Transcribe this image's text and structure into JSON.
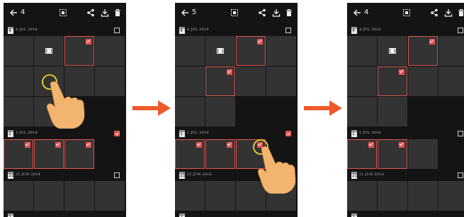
{
  "colors": {
    "background": "#141414",
    "thumbnail": "#333333",
    "selection": "#e8524f",
    "arrow": "#ee5a2a",
    "hand": "#f2b46e",
    "touch_ring": "#f2d22e"
  },
  "icons": [
    "back-arrow-icon",
    "select-all-icon",
    "share-icon",
    "download-icon",
    "delete-icon",
    "calendar-icon",
    "video-icon",
    "checkbox-icon",
    "pointing-hand-icon",
    "touch-ring-icon",
    "flow-arrow-icon"
  ],
  "screens": [
    {
      "count": "4",
      "sections": [
        {
          "day": "4",
          "date": "4 JUL 2014",
          "checked": false,
          "rows": 3,
          "cells": [
            "",
            "video",
            "sel",
            "",
            "",
            "",
            "",
            "",
            "",
            "",
            "",
            ""
          ]
        },
        {
          "day": "1",
          "date": "1 JUL 2014",
          "checked": true,
          "rows": 1,
          "cells": [
            "sel",
            "sel",
            "sel"
          ]
        },
        {
          "day": "21",
          "date": "21 JUN 2014",
          "checked": false,
          "rows": 1,
          "cells": [
            "",
            "",
            "",
            ""
          ]
        },
        {
          "day": "2",
          "date": "",
          "checked": false,
          "rows": 0,
          "cells": []
        }
      ],
      "gesture": {
        "type": "tap",
        "cell": "section 1, row 2, column 2"
      }
    },
    {
      "count": "5",
      "sections": [
        {
          "day": "4",
          "date": "4 JUL 2014",
          "checked": false,
          "rows": 3,
          "cells": [
            "",
            "video",
            "sel",
            "",
            "",
            "sel",
            "",
            "",
            "",
            "",
            "",
            ""
          ]
        },
        {
          "day": "1",
          "date": "1 JUL 2014",
          "checked": true,
          "rows": 1,
          "cells": [
            "sel",
            "sel",
            "sel"
          ]
        },
        {
          "day": "21",
          "date": "21 JUN 2014",
          "checked": false,
          "rows": 1,
          "cells": [
            "",
            "",
            "",
            ""
          ]
        },
        {
          "day": "2",
          "date": "",
          "checked": false,
          "rows": 0,
          "cells": []
        }
      ],
      "gesture": {
        "type": "tap",
        "cell": "section 2, column 3"
      }
    },
    {
      "count": "4",
      "sections": [
        {
          "day": "4",
          "date": "4 JUL 2014",
          "checked": false,
          "rows": 3,
          "cells": [
            "",
            "video",
            "sel",
            "",
            "",
            "sel",
            "",
            "",
            "",
            "",
            "",
            ""
          ]
        },
        {
          "day": "1",
          "date": "1 JUL 2014",
          "checked": false,
          "rows": 1,
          "cells": [
            "sel",
            "sel",
            ""
          ]
        },
        {
          "day": "21",
          "date": "21 JUN 2014",
          "checked": false,
          "rows": 1,
          "cells": [
            "",
            "",
            "",
            ""
          ]
        },
        {
          "day": "2",
          "date": "",
          "checked": false,
          "rows": 0,
          "cells": []
        }
      ],
      "gesture": null
    }
  ]
}
